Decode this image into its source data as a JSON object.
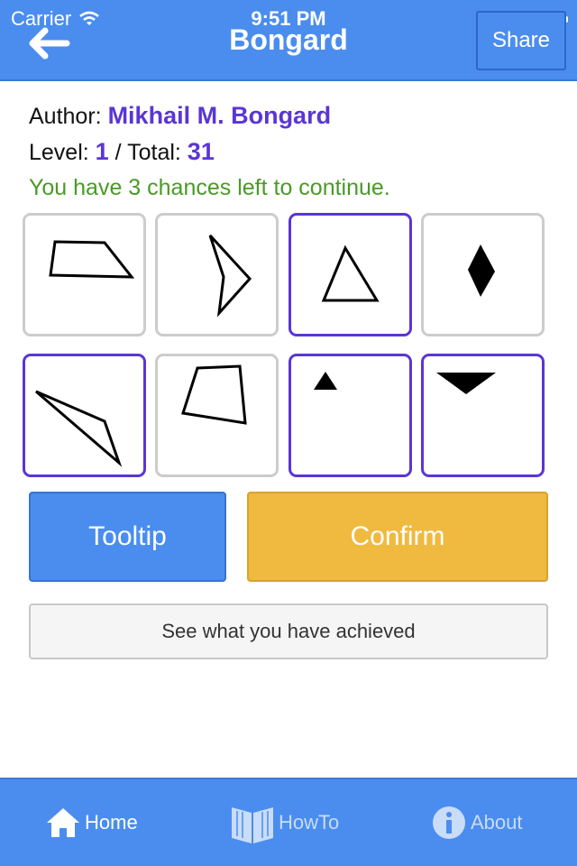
{
  "status_bar": {
    "carrier": "Carrier",
    "time": "9:51 PM"
  },
  "header": {
    "title": "Bongard",
    "share_label": "Share",
    "back_icon": "arrow-left-icon"
  },
  "info": {
    "author_label": "Author: ",
    "author_name": "Mikhail M. Bongard",
    "level_label": "Level: ",
    "level_value": "1",
    "total_label": " / Total: ",
    "total_value": "31",
    "chances_text": "You have 3 chances left to continue."
  },
  "grid": {
    "cells": [
      {
        "shape": "trapezoid-outline",
        "selected": false
      },
      {
        "shape": "arrowhead-outline",
        "selected": false
      },
      {
        "shape": "triangle-outline",
        "selected": true
      },
      {
        "shape": "diamond-filled",
        "selected": false
      },
      {
        "shape": "thin-triangle-outline",
        "selected": true
      },
      {
        "shape": "quadrilateral-outline",
        "selected": false
      },
      {
        "shape": "small-triangle-filled",
        "selected": true
      },
      {
        "shape": "inverted-triangle-filled",
        "selected": true
      }
    ]
  },
  "buttons": {
    "tooltip": "Tooltip",
    "confirm": "Confirm",
    "achieved": "See what you have achieved"
  },
  "tabs": [
    {
      "label": "Home",
      "icon": "home-icon",
      "active": true
    },
    {
      "label": "HowTo",
      "icon": "book-icon",
      "active": false
    },
    {
      "label": "About",
      "icon": "info-icon",
      "active": false
    }
  ],
  "colors": {
    "primary_blue": "#4a8def",
    "accent_purple": "#5b35d5",
    "confirm_orange": "#f0b940",
    "chances_green": "#4a9a26"
  }
}
